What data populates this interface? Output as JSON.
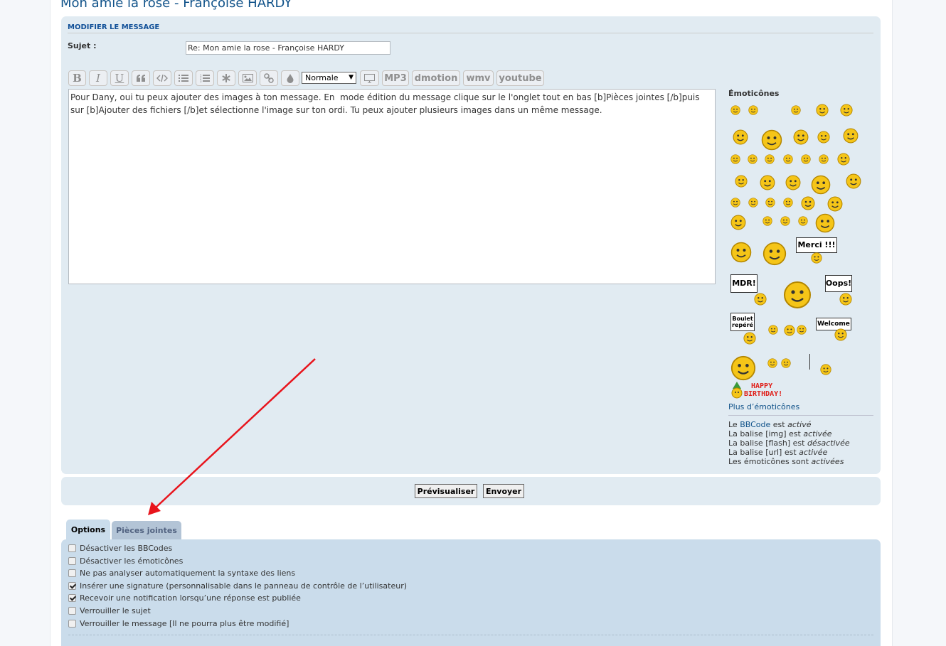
{
  "page": {
    "title": "Mon amie la rose - Françoise HARDY"
  },
  "form": {
    "section_heading": "MODIFIER LE MESSAGE",
    "subject_label": "Sujet :",
    "subject_value": "Re: Mon amie la rose - Françoise HARDY"
  },
  "toolbar": {
    "bold": "B",
    "italic": "I",
    "underline": "U",
    "quote_icon": "quote-icon",
    "code_icon": "code-icon",
    "list_icon": "list-icon",
    "ordered_list_icon": "ordered-list-icon",
    "list_item_icon": "asterisk-icon",
    "image_icon": "image-icon",
    "link_icon": "link-icon",
    "color_icon": "drop-icon",
    "font_size_value": "Normale",
    "video_icon": "monitor-icon",
    "mp3": "MP3",
    "dmotion": "dmotion",
    "wmv": "wmv",
    "youtube": "youtube"
  },
  "message": {
    "text": "Pour Dany, oui tu peux ajouter des images à ton message. En  mode édition du message clique sur le l'onglet tout en bas [b]Pièces jointes [/b]puis sur [b]Ajouter des fichiers [/b]et sélectionne l'image sur ton ordi. Tu peux ajouter plusieurs images dans un même message."
  },
  "smilies": {
    "title": "Émoticônes",
    "more_link": "Plus d’émoticônes",
    "sign_merci": "Merci !!!",
    "sign_mdr": "MDR!",
    "sign_oops": "Oops!",
    "sign_boulet_1": "Boulet",
    "sign_boulet_2": "repéré",
    "sign_welcome": "Welcome",
    "birthday_1": "HAPPY",
    "birthday_2": "BIRTHDAY!"
  },
  "bbcode_status": {
    "line1_prefix": "Le ",
    "line1_link": "BBCode",
    "line1_mid": " est ",
    "line1_state": "activé",
    "line2_prefix": "La balise [img] est ",
    "line2_state": "activée",
    "line3_prefix": "La balise [flash] est ",
    "line3_state": "désactivée",
    "line4_prefix": "La balise [url] est ",
    "line4_state": "activée",
    "line5_prefix": "Les émoticônes sont ",
    "line5_state": "activées"
  },
  "buttons": {
    "preview": "Prévisualiser",
    "submit": "Envoyer"
  },
  "tabs": {
    "options": "Options",
    "attachments": "Pièces jointes"
  },
  "options": [
    {
      "label": "Désactiver les BBCodes",
      "checked": false
    },
    {
      "label": "Désactiver les émoticônes",
      "checked": false
    },
    {
      "label": "Ne pas analyser automatiquement la syntaxe des liens",
      "checked": false
    },
    {
      "label": "Insérer une signature (personnalisable dans le panneau de contrôle de l’utilisateur)",
      "checked": true
    },
    {
      "label": "Recevoir une notification lorsqu’une réponse est publiée",
      "checked": true
    },
    {
      "label": "Verrouiller le sujet",
      "checked": false
    },
    {
      "label": "Verrouiller le message [Il ne pourra plus être modifié]",
      "checked": false
    }
  ],
  "colors": {
    "annotation_arrow": "#e8141c",
    "heading": "#105289",
    "panel": "#e1ebf2",
    "options_panel": "#cadceb"
  }
}
